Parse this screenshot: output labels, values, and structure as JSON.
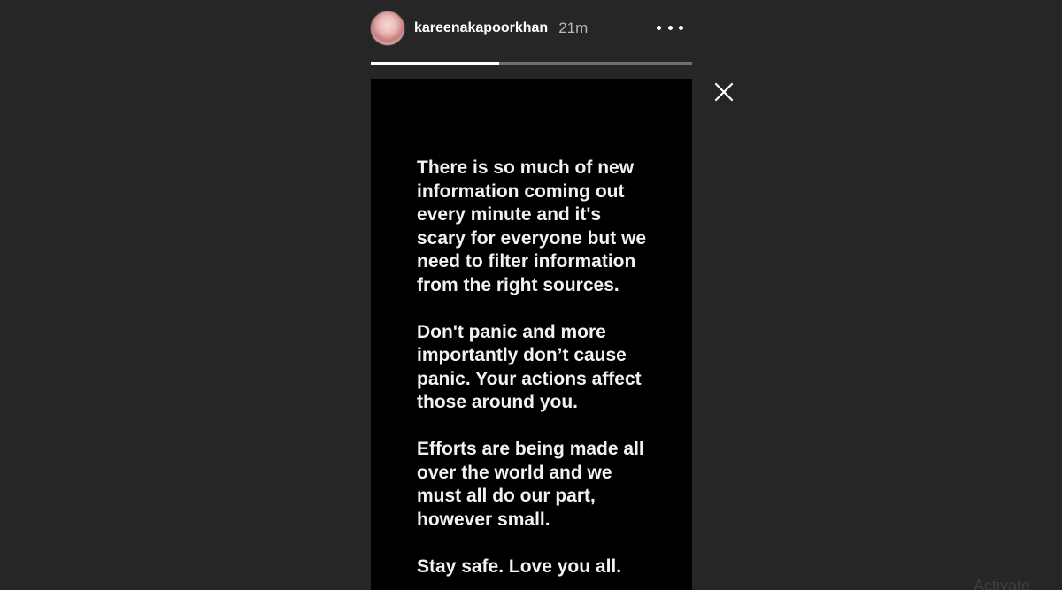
{
  "story": {
    "username": "kareenakapoorkhan",
    "time_ago": "21m",
    "avatar_icon": "profile-avatar",
    "more_icon": "more-options-dots",
    "close_icon": "close-x",
    "progress_fraction": 0.4,
    "paragraphs": [
      "There is so much of new\ninformation coming out\nevery minute and it's\nscary for everyone but we\nneed to filter information\nfrom the right sources.",
      "Don't panic and more\nimportantly don’t cause\npanic. Your actions affect\nthose around you.",
      "Efforts are being made all\nover the world and we\nmust all do our part,\nhowever small.",
      "Stay safe. Love you all."
    ]
  },
  "watermark": {
    "text": "Activate"
  },
  "colors": {
    "background": "#262626",
    "card": "#000000",
    "text": "#f2f2f2",
    "progress_track": "#6f6f6f",
    "progress_fill": "#ffffff"
  }
}
